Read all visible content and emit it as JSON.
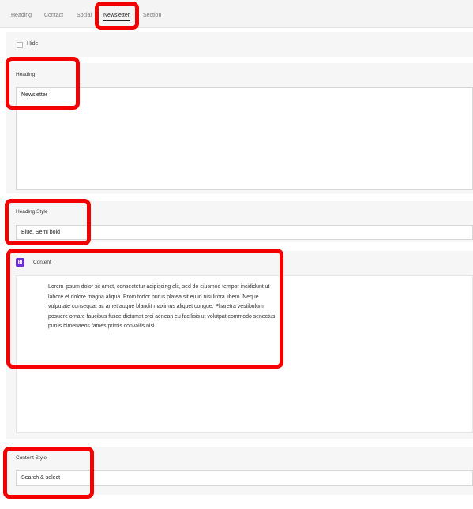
{
  "tabs": [
    {
      "label": "Heading",
      "active": false
    },
    {
      "label": "Contact",
      "active": false
    },
    {
      "label": "Social",
      "active": false
    },
    {
      "label": "Newsletter",
      "active": true
    },
    {
      "label": "Section",
      "active": false
    }
  ],
  "hide": {
    "label": "Hide",
    "checked": false
  },
  "heading": {
    "label": "Heading",
    "value": "Newsletter"
  },
  "heading_style": {
    "label": "Heading Style",
    "value": "Blue, Semi bold"
  },
  "content": {
    "label": "Content",
    "icon": "editor-icon",
    "icon_color": "#6f2fd6",
    "text": "Lorem ipsum dolor sit amet, consectetur adipiscing elit, sed do eiusmod tempor incididunt ut labore et dolore magna aliqua. Proin tortor purus platea sit eu id nisi litora libero. Neque vulputate consequat ac amet augue blandit maximus aliquet congue. Pharetra vestibulum posuere ornare faucibus fusce dictumst orci aenean eu facilisis ut volutpat commodo senectus purus himenaeos fames primis convallis nisi."
  },
  "content_style": {
    "label": "Content Style",
    "placeholder": "Search & select"
  },
  "highlight_color": "#f40000"
}
